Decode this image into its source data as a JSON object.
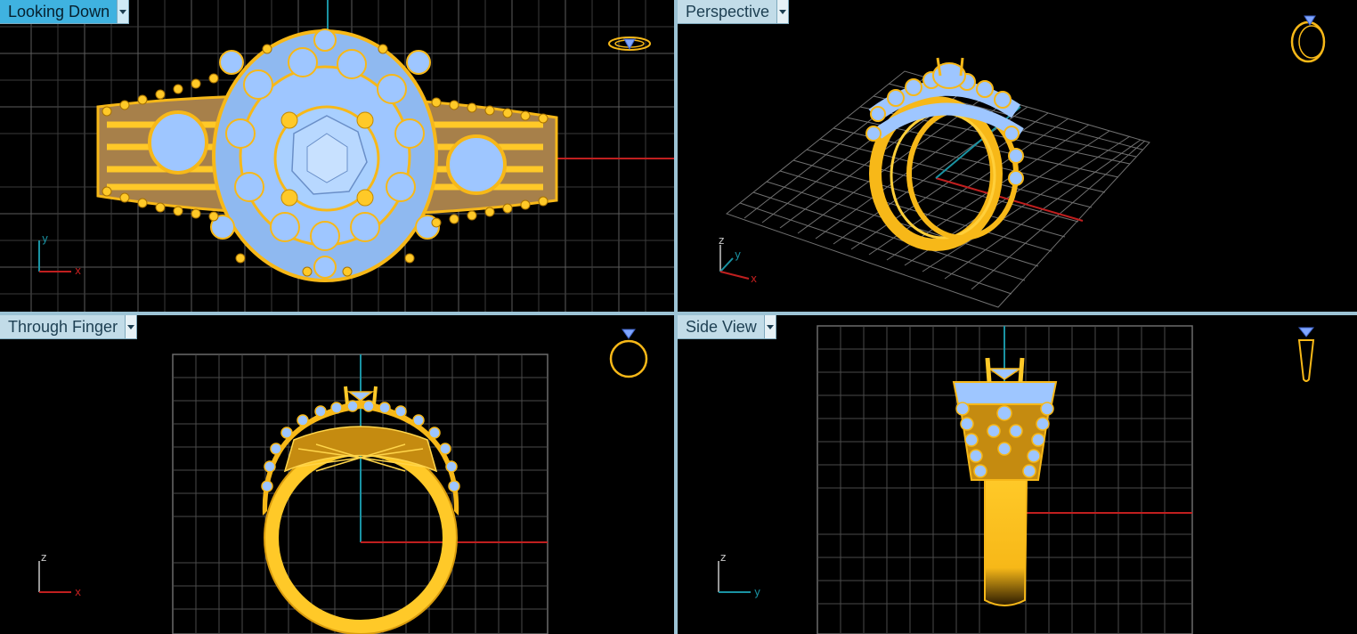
{
  "viewports": {
    "top": {
      "title": "Looking Down",
      "active": true,
      "axes": [
        "y",
        "x"
      ]
    },
    "perspective": {
      "title": "Perspective",
      "active": false,
      "axes": [
        "z",
        "y",
        "x"
      ]
    },
    "front": {
      "title": "Through Finger",
      "active": false,
      "axes": [
        "z",
        "x"
      ]
    },
    "right": {
      "title": "Side View",
      "active": false,
      "axes": [
        "z",
        "y"
      ]
    }
  },
  "icons": [
    "ring-preview-icon",
    "viewport-menu-icon",
    "axis-gizmo-icon"
  ],
  "colors": {
    "viewport_bg": "#000000",
    "frame": "#9cc3d5",
    "tab_active": "#3fb2e0",
    "tab_inactive": "#c2dce8",
    "grid": "#6b6b6b",
    "x_axis": "#c01f1f",
    "y_axis": "#1a93a3",
    "gold": "#f7b818",
    "gem": "#9ec6ff"
  }
}
